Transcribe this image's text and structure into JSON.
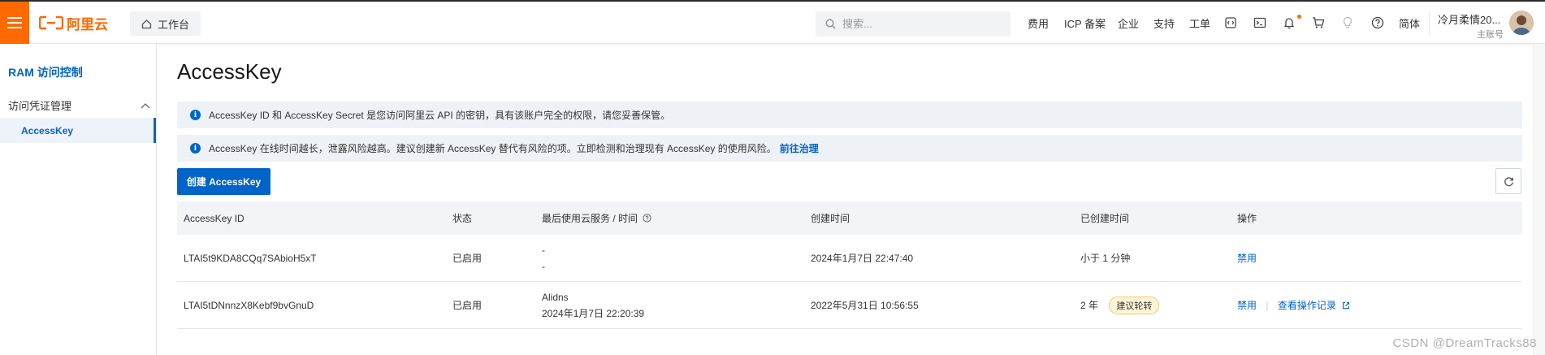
{
  "topbar": {
    "logo_text": "阿里云",
    "workbench_label": "工作台",
    "search_placeholder": "搜索...",
    "links": [
      "费用",
      "ICP 备案",
      "企业",
      "支持",
      "工单"
    ],
    "lang_label": "简体",
    "user_name": "冷月柔情20...",
    "user_role": "主账号",
    "brand_color": "#ff6a00"
  },
  "sidebar": {
    "title": "RAM 访问控制",
    "group_label": "访问凭证管理",
    "active_item": "AccessKey",
    "accent_color": "#0064c8"
  },
  "main": {
    "page_title": "AccessKey",
    "alerts": [
      {
        "text": "AccessKey ID 和 AccessKey Secret 是您访问阿里云 API 的密钥，具有该账户完全的权限，请您妥善保管。",
        "link": ""
      },
      {
        "text": "AccessKey 在线时间越长，泄露风险越高。建议创建新 AccessKey 替代有风险的项。立即检测和治理现有 AccessKey 的使用风险。",
        "link": "前往治理"
      }
    ],
    "create_button": "创建 AccessKey",
    "table": {
      "headers": [
        "AccessKey ID",
        "状态",
        "最后使用云服务 / 时间",
        "创建时间",
        "已创建时间",
        "操作"
      ],
      "rows": [
        {
          "id": "LTAI5t9KDA8CQq7SAbioH5xT",
          "status": "已启用",
          "last_service": "-",
          "last_time": "-",
          "created": "2024年1月7日 22:47:40",
          "age": "小于 1 分钟",
          "badge": "",
          "action1": "禁用",
          "action2": ""
        },
        {
          "id": "LTAI5tDNnnzX8Kebf9bvGnuD",
          "status": "已启用",
          "last_service": "Alidns",
          "last_time": "2024年1月7日 22:20:39",
          "created": "2022年5月31日 10:56:55",
          "age": "2 年",
          "badge": "建议轮转",
          "action1": "禁用",
          "action2": "查看操作记录"
        }
      ]
    }
  },
  "watermark": "CSDN @DreamTracks88"
}
